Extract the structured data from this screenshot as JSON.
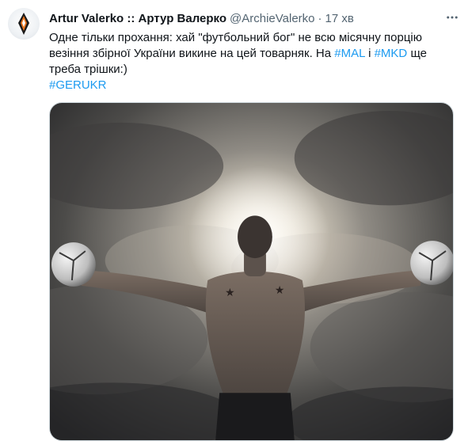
{
  "tweet": {
    "author_name": "Artur Valerko :: Артур Валерко",
    "handle": "@ArchieValerko",
    "separator": "·",
    "time": "17 хв",
    "text_line1": "Одне тільки прохання: хай \"футбольний бог\" не всю місячну порцію",
    "text_line2_prefix": "везіння збірної України викине на цей товарняк. На ",
    "hashtag1": "#MAL",
    "text_between": " і ",
    "hashtag2": "#MKD",
    "text_line2_suffix": " ще",
    "text_line3": "треба трішки:)",
    "hashtag3": "#GERUKR"
  },
  "icons": {
    "avatar": "avatar-image",
    "more": "more-options-icon"
  },
  "colors": {
    "text": "#0f1419",
    "secondary": "#536471",
    "link": "#1d9bf0",
    "border": "#cfd9de"
  }
}
